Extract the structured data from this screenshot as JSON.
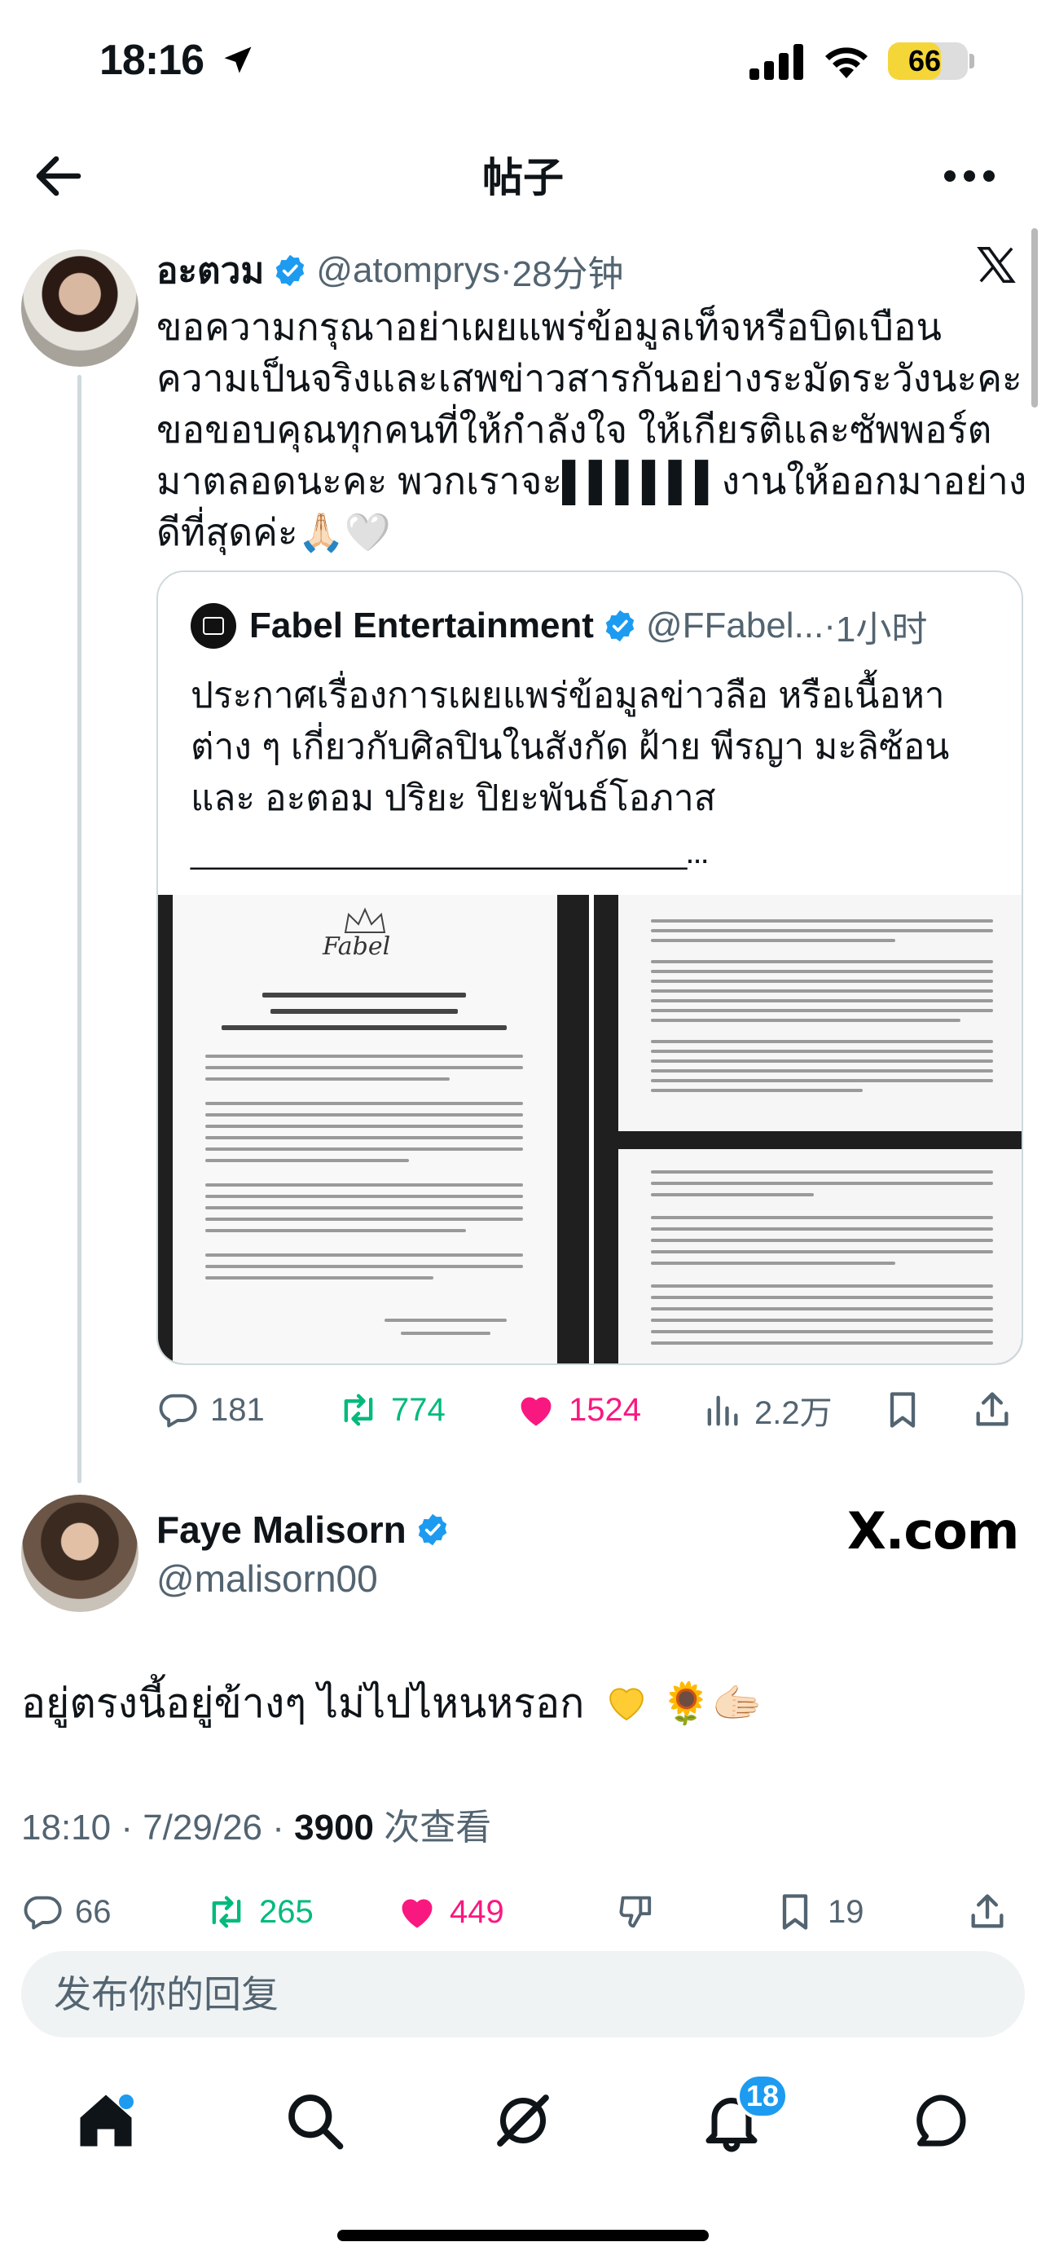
{
  "status_bar": {
    "time": "18:16",
    "battery": "66",
    "battery_level": 0.66,
    "battery_color": "#f5d638"
  },
  "header": {
    "title": "帖子",
    "back_icon": "arrow-left-icon",
    "more_icon": "more-horizontal-icon"
  },
  "post1": {
    "display_name": "อะตวม",
    "handle": "@atomprys",
    "dot": "·",
    "time": "28分钟",
    "text": "ขอความกรุณาอย่าเผยแพร่ข้อมูลเท็จหรือบิดเบือนความเป็นจริงและเสพข่าวสารกันอย่างระมัดระวังนะคะ ขอขอบคุณทุกคนที่ให้กำลังใจ ให้เกียรติและซัพพอร์ตมาตลอดนะคะ พวกเราจะ▌▌▌▌▌▌งานให้ออกมาอย่างดีที่สุดค่ะ🙏🏻🤍",
    "quote": {
      "display_name": "Fabel Entertainment",
      "handle": "@FFabel...",
      "dot": "·",
      "time": "1小时",
      "text": "ประกาศเรื่องการเผยแพร่ข้อมูลข่าวลือ หรือเนื้อหาต่าง ๆ เกี่ยวกับศิลปินในสังกัด ฝ้าย พีรญา มะลิซ้อน และ อะตอม ปริยะ ปิยะพันธ์โอภาส",
      "underline": "______________________________..."
    },
    "actions": {
      "replies": "181",
      "retweets": "774",
      "likes": "1524",
      "views": "2.2万"
    }
  },
  "post2": {
    "display_name": "Faye Malisorn",
    "handle": "@malisorn00",
    "watermark": "X.com",
    "text": "อยู่ตรงนี้อยู่ข้างๆ ไม่ไปไหนหรอก",
    "text_emoji": "🌻🫱🏻",
    "meta_prefix": "18:10 · 7/29/26 · ",
    "views": "3900",
    "views_label": " 次查看",
    "actions": {
      "replies": "66",
      "retweets": "265",
      "likes": "449",
      "bookmarks": "19"
    }
  },
  "composer": {
    "placeholder": "发布你的回复"
  },
  "tab_bar": {
    "items": [
      "home-icon",
      "search-icon",
      "grok-icon",
      "notifications-icon",
      "messages-icon"
    ],
    "notification_count": "18"
  },
  "colors": {
    "accent": "#1d9bf0",
    "retweet": "#00ba7c",
    "like": "#f91880",
    "muted": "#536471"
  }
}
